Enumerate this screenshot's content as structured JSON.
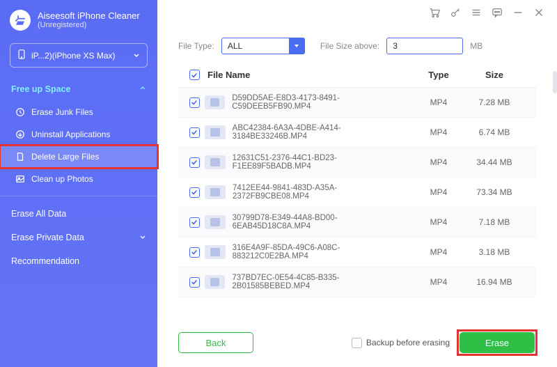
{
  "app": {
    "title": "Aiseesoft iPhone",
    "subtitle": "Cleaner",
    "status": "(Unregistered)"
  },
  "device": {
    "label": "iP...2)(iPhone XS Max)"
  },
  "sidebar": {
    "section_free": "Free up Space",
    "items": [
      {
        "label": "Erase Junk Files"
      },
      {
        "label": "Uninstall Applications"
      },
      {
        "label": "Delete Large Files"
      },
      {
        "label": "Clean up Photos"
      }
    ],
    "erase_all": "Erase All Data",
    "erase_private": "Erase Private Data",
    "recommendation": "Recommendation"
  },
  "filters": {
    "file_type_label": "File Type:",
    "file_type_value": "ALL",
    "size_above_label": "File Size above:",
    "size_above_value": "3",
    "size_unit": "MB"
  },
  "table": {
    "headers": {
      "name": "File Name",
      "type": "Type",
      "size": "Size"
    },
    "rows": [
      {
        "name": "D59DD5AE-E8D3-4173-8491-C59DEEB5FB90.MP4",
        "type": "MP4",
        "size": "7.28 MB"
      },
      {
        "name": "ABC42384-6A3A-4DBE-A414-3184BE33246B.MP4",
        "type": "MP4",
        "size": "6.74 MB"
      },
      {
        "name": "12631C51-2376-44C1-BD23-F1EE89F5BADB.MP4",
        "type": "MP4",
        "size": "34.44 MB"
      },
      {
        "name": "7412EE44-9841-483D-A35A-2372FB9CBE08.MP4",
        "type": "MP4",
        "size": "73.34 MB"
      },
      {
        "name": "30799D78-E349-44A8-BD00-6EAB45D18C8A.MP4",
        "type": "MP4",
        "size": "7.18 MB"
      },
      {
        "name": "316E4A9F-85DA-49C6-A08C-883212C0E2BA.MP4",
        "type": "MP4",
        "size": "3.18 MB"
      },
      {
        "name": "737BD7EC-0E54-4C85-B335-2B01585BEBED.MP4",
        "type": "MP4",
        "size": "16.94 MB"
      }
    ]
  },
  "footer": {
    "back": "Back",
    "backup_label": "Backup before erasing",
    "erase": "Erase"
  }
}
